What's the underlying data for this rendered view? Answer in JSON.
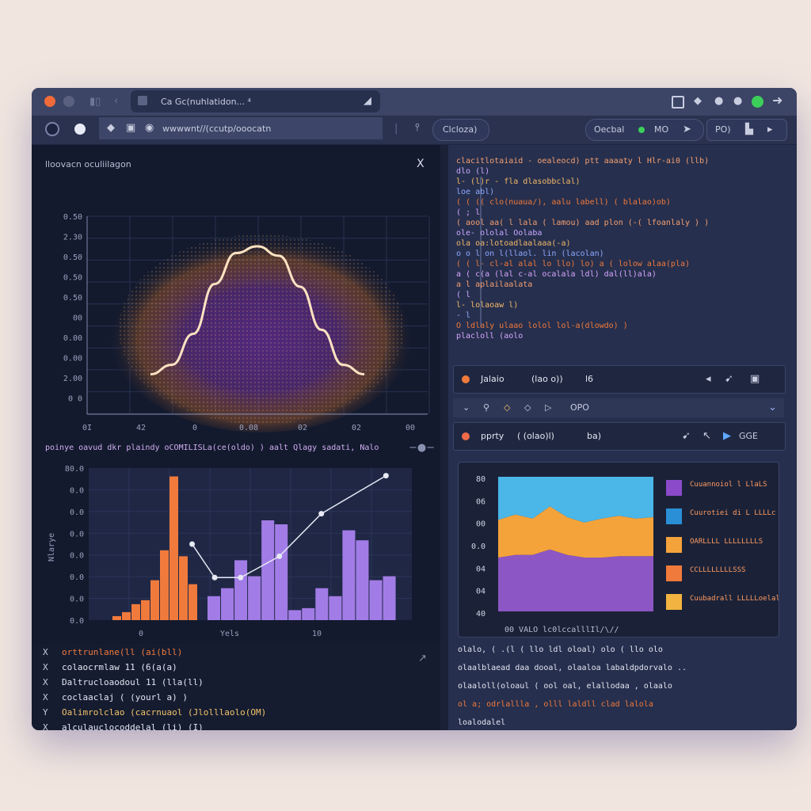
{
  "window": {
    "tab_title": "Ca Gc(nuhlatidon... ⁴",
    "address": "wwwwnt//(ccutp/ooocatn",
    "toolbar_pill_left": "Clcloza)",
    "toolbar_pill_mid_label": "Oecbal",
    "toolbar_pill_mid_value": "MO",
    "toolbar_pill_right": "PO)"
  },
  "colors": {
    "accent_orange": "#f07a3c",
    "accent_purple": "#9a6ce0",
    "accent_cyan": "#4bb6e8",
    "accent_yellow": "#f2a93b",
    "green_status": "#3ccf5a"
  },
  "density_plot": {
    "title": "lloovacn oculiilagon",
    "close_label": "X",
    "chart_data": {
      "type": "scatter",
      "title": "lloovacn oculiilagon",
      "y_tick_labels": [
        "0.50",
        "2.30",
        "0.50",
        "0.50",
        "0.50",
        "00",
        "0.00",
        "0.00",
        "2.00",
        "0 0"
      ],
      "x_tick_labels": [
        "0I",
        "42",
        "0",
        "0.08",
        "02",
        "02",
        "00"
      ],
      "curve_x": [
        0,
        10,
        20,
        30,
        40,
        50,
        60,
        70,
        80,
        90,
        100
      ],
      "curve_y": [
        0.05,
        0.12,
        0.35,
        0.72,
        0.95,
        1.0,
        0.93,
        0.7,
        0.38,
        0.12,
        0.05
      ]
    }
  },
  "histogram": {
    "header": "poinye oavud dkr plaindy oCOMILISLa(ce(oldo) )  aalt Qlagy sadati, Nalo",
    "chart_data": {
      "type": "bar",
      "ylabel": "Nlarye",
      "xlabel": "Yels",
      "y_tick_labels": [
        "80.0",
        "0.0",
        "0.0",
        "0.0",
        "0.0",
        "0.0",
        "0.0",
        "0.0"
      ],
      "x_tick_labels": [
        "0",
        "Yels",
        "10"
      ],
      "values_orange": [
        2,
        4,
        8,
        10,
        20,
        35,
        72,
        32,
        18
      ],
      "values_purple": [
        12,
        16,
        30,
        22,
        50,
        48,
        5,
        6,
        16,
        12,
        45,
        40,
        20,
        22
      ],
      "line_points": [
        [
          0.32,
          0.5
        ],
        [
          0.39,
          0.28
        ],
        [
          0.47,
          0.28
        ],
        [
          0.59,
          0.42
        ],
        [
          0.72,
          0.7
        ],
        [
          0.92,
          0.95
        ]
      ]
    }
  },
  "log_lines": [
    {
      "marker": "X",
      "text": "orttrunlane(ll  (ai(bll)"
    },
    {
      "marker": "X",
      "text": "colaocrmlaw 11 (6(a(a)"
    },
    {
      "marker": "X",
      "text": "Daltrucloaodoul 11 (lla(ll)"
    },
    {
      "marker": "X",
      "text": "coclaaclaj ( (yourl a) )"
    },
    {
      "marker": "Y",
      "text": "Oalimrolclao (cacrnuaol (Jlolllaolo(OM)"
    },
    {
      "marker": "X",
      "text": "alculauclocoddelal (li) (I)"
    }
  ],
  "code_editor": {
    "lines": [
      "clacitlotaiaid - oealeocd) ptt aaaaty l Hlr-ai0 (llb)",
      "  dlo (l)",
      "  l- (l)r - fla dlasobbclal)",
      "    loe abl)",
      "  ( ( (( clo(nuaua/), aalu labell) ( blalao)ob)",
      "  ( ; l",
      "  ( aool aa( l lala ( lamou) aad plon (-( lfoanlaly ) )",
      "  ole- ololal Oolaba",
      "  ola oa:lotoadlaalaaa(-a)",
      "  o o l on l(llaol. lin (lacolan)",
      "  ( (  l- cl-al alal lo llo) lo) a ( lolow alaa(pla)",
      "     a ( c(a (lal c-al ocalala ldl) dal(ll)ala)",
      "  a l aplailaalata",
      "    ( l",
      "         l- lolaoaw l)",
      "  - l",
      "      O ldlaly ulaao lolol lol-a(dlowdo) )",
      "  placloll (aolo"
    ]
  },
  "run_bar_1": {
    "label": "Jalaio",
    "args": "(lao o))",
    "suffix": "l6"
  },
  "small_toolbar": {
    "items": [
      "⌄",
      "⚲",
      "◇",
      "◇",
      "▷",
      "OPO"
    ]
  },
  "run_bar_2": {
    "label": "pprty",
    "args": "( (olao)l)",
    "suffix": "ba)",
    "action": "GGE"
  },
  "area_chart": {
    "chart_data": {
      "type": "area",
      "y_tick_labels": [
        "80",
        "06",
        "00",
        "0.0",
        "04",
        "04",
        "40"
      ],
      "x_tick_label": "00  VALO  lc0lccalllIl/\\//",
      "series": [
        {
          "name": "Cuuannoiol l LlaLS",
          "values": [
            0.32,
            0.28,
            0.31,
            0.22,
            0.3,
            0.34,
            0.31,
            0.29,
            0.31,
            0.3
          ]
        },
        {
          "name": "Cuurotiei di L LLLLc",
          "values": [
            0.0,
            0.0,
            0.0,
            0.0,
            0.0,
            0.0,
            0.0,
            0.0,
            0.0,
            0.0
          ]
        },
        {
          "name": "OARLLLL LLLLLLLLS",
          "values": [
            0.28,
            0.3,
            0.27,
            0.32,
            0.28,
            0.26,
            0.29,
            0.3,
            0.28,
            0.29
          ]
        },
        {
          "name": "CCLLLLLLLLSSS",
          "values": [
            0.4,
            0.42,
            0.42,
            0.46,
            0.42,
            0.4,
            0.4,
            0.41,
            0.41,
            0.41
          ]
        },
        {
          "name": "Cuubadrall LLLLLoelal",
          "values": [
            0.0,
            0.0,
            0.0,
            0.0,
            0.0,
            0.0,
            0.0,
            0.0,
            0.0,
            0.0
          ]
        }
      ]
    },
    "legend": [
      {
        "label": "Cuuannoiol l LlaLS",
        "color": "#8b4ac9"
      },
      {
        "label": "Cuurotiei di L LLLLc",
        "color": "#2a8fd6"
      },
      {
        "label": "OARLLLL LLLLLLLLS",
        "color": "#f4a33b"
      },
      {
        "label": "CCLLLLLLLLSSS",
        "color": "#f07a3c"
      },
      {
        "label": "Cuubadrall LLLLLoelal",
        "color": "#f2b340"
      }
    ]
  },
  "console_lines": [
    "olalo, ( .(l ( llo ldl oloal) olo ( llo olo",
    "olaalblaead daa dooal, olaaloa labaldpdorvalo ..",
    "olaaloll(oloaul ( ool oal, elallodaa , olaalo",
    "ol a;  odrlallla , olll  laldll clad lalola",
    "loalodalel"
  ]
}
